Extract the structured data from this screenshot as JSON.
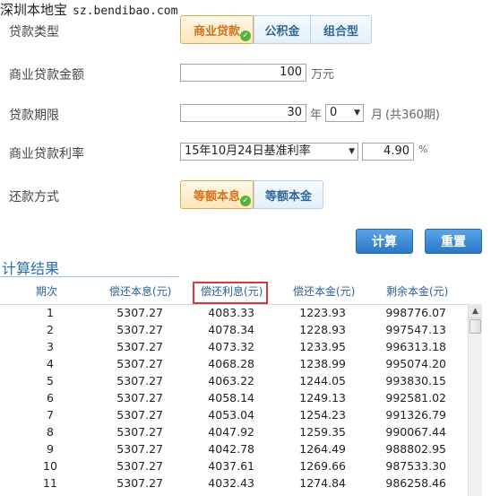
{
  "watermark": {
    "site_name": "深圳本地宝",
    "site_url": "sz.bendibao.com"
  },
  "form": {
    "loan_type": {
      "label": "贷款类型",
      "options": [
        "商业贷款",
        "公积金",
        "组合型"
      ]
    },
    "amount": {
      "label": "商业贷款金额",
      "value": "100",
      "unit": "万元"
    },
    "term": {
      "label": "贷款期限",
      "years": "30",
      "year_unit": "年",
      "months": "0",
      "month_unit": "月",
      "total_note": "(共360期)"
    },
    "rate": {
      "label": "商业贷款利率",
      "rate_option": "15年10月24日基准利率",
      "rate_value": "4.90",
      "percent": "%"
    },
    "repayment": {
      "label": "还款方式",
      "options": [
        "等额本息",
        "等额本金"
      ]
    },
    "buttons": {
      "calculate": "计算",
      "reset": "重置"
    }
  },
  "results": {
    "title": "计算结果",
    "columns": [
      "期次",
      "偿还本息(元)",
      "偿还利息(元)",
      "偿还本金(元)",
      "剩余本金(元)"
    ],
    "rows": [
      [
        "1",
        "5307.27",
        "4083.33",
        "1223.93",
        "998776.07"
      ],
      [
        "2",
        "5307.27",
        "4078.34",
        "1228.93",
        "997547.13"
      ],
      [
        "3",
        "5307.27",
        "4073.32",
        "1233.95",
        "996313.18"
      ],
      [
        "4",
        "5307.27",
        "4068.28",
        "1238.99",
        "995074.20"
      ],
      [
        "5",
        "5307.27",
        "4063.22",
        "1244.05",
        "993830.15"
      ],
      [
        "6",
        "5307.27",
        "4058.14",
        "1249.13",
        "992581.02"
      ],
      [
        "7",
        "5307.27",
        "4053.04",
        "1254.23",
        "991326.79"
      ],
      [
        "8",
        "5307.27",
        "4047.92",
        "1259.35",
        "990067.44"
      ],
      [
        "9",
        "5307.27",
        "4042.78",
        "1264.49",
        "988802.95"
      ],
      [
        "10",
        "5307.27",
        "4037.61",
        "1269.66",
        "987533.30"
      ],
      [
        "11",
        "5307.27",
        "4032.43",
        "1274.84",
        "986258.46"
      ]
    ]
  },
  "colors": {
    "accent_blue": "#2a6bb8",
    "active_orange": "#d4721b",
    "highlight_red": "#d9363e",
    "check_green": "#53b33a"
  }
}
